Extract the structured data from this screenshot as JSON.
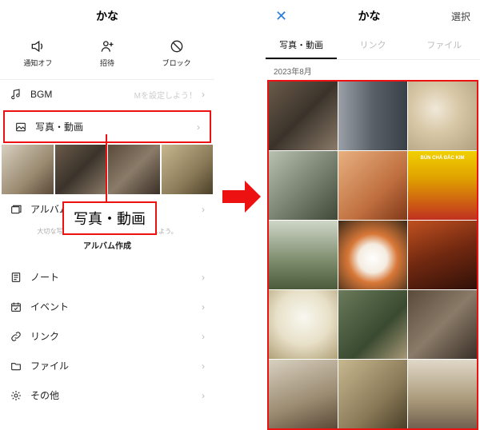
{
  "left": {
    "header": {
      "title": "かな"
    },
    "actions": {
      "mute": "通知オフ",
      "invite": "招待",
      "block": "ブロック"
    },
    "bgm": {
      "label": "BGM",
      "hint": "Mを設定しよう！"
    },
    "photos": {
      "label": "写真・動画"
    },
    "album": {
      "label": "アルバム",
      "subtext": "大切な写真はアルバムを作成してシェアしよう。",
      "button": "アルバム作成"
    },
    "note": "ノート",
    "event": "イベント",
    "link": "リンク",
    "file": "ファイル",
    "other": "その他",
    "callout": "写真・動画"
  },
  "right": {
    "header": {
      "title": "かな",
      "select": "選択"
    },
    "tabs": {
      "photos": "写真・動画",
      "link": "リンク",
      "file": "ファイル"
    },
    "date": "2023年8月"
  }
}
